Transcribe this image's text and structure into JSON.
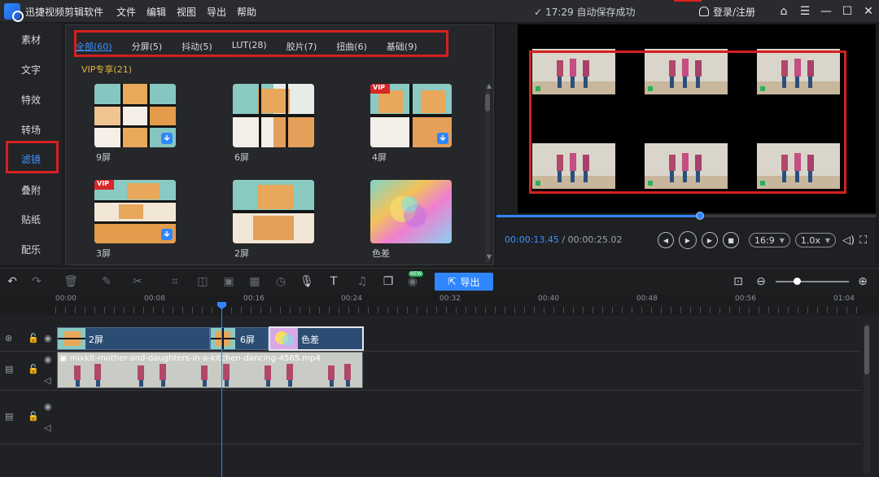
{
  "app": {
    "title": "迅捷视频剪辑软件",
    "menu": [
      "文件",
      "编辑",
      "视图",
      "导出",
      "帮助"
    ]
  },
  "status": {
    "autosave": "17:29 自动保存成功"
  },
  "account": {
    "login": "登录/注册"
  },
  "window_controls": {
    "home": "⌂",
    "menu": "☰",
    "minimize": "—",
    "maximize": "☐",
    "close": "✕"
  },
  "sidebar": {
    "items": [
      "素材",
      "文字",
      "特效",
      "转场",
      "滤镜",
      "叠附",
      "贴纸",
      "配乐"
    ],
    "active_index": 4
  },
  "library": {
    "tabs": [
      "全部(60)",
      "分屏(5)",
      "抖动(5)",
      "LUT(28)",
      "胶片(7)",
      "扭曲(6)",
      "基础(9)"
    ],
    "active_tab": 0,
    "section_title": "VIP专享(21)",
    "filters": [
      {
        "label": "9屏",
        "vip": false,
        "download": true
      },
      {
        "label": "6屏",
        "vip": false,
        "download": false
      },
      {
        "label": "4屏",
        "vip": true,
        "download": true
      },
      {
        "label": "3屏",
        "vip": true,
        "download": true
      },
      {
        "label": "2屏",
        "vip": false,
        "download": false
      },
      {
        "label": "色差",
        "vip": false,
        "download": false
      }
    ],
    "vip_badge": "VIP"
  },
  "player": {
    "current_time": "00:00:13.45",
    "separator": " / ",
    "total_time": "00:00:25.02",
    "progress": 0.536,
    "aspect": "16:9",
    "speed": "1.0x"
  },
  "toolbar": {
    "export_label": "导出",
    "new_badge": "NEW"
  },
  "timeline": {
    "ruler_labels": [
      "00:00",
      "00:08",
      "00:16",
      "00:24",
      "00:32",
      "00:40",
      "00:48",
      "00:56",
      "01:04"
    ],
    "filter_clips": [
      "2屏",
      "6屏",
      "色差"
    ],
    "video_clip_name": "mixkit-mother-and-daughters-in-a-kitchen-dancing-4565.mp4"
  }
}
